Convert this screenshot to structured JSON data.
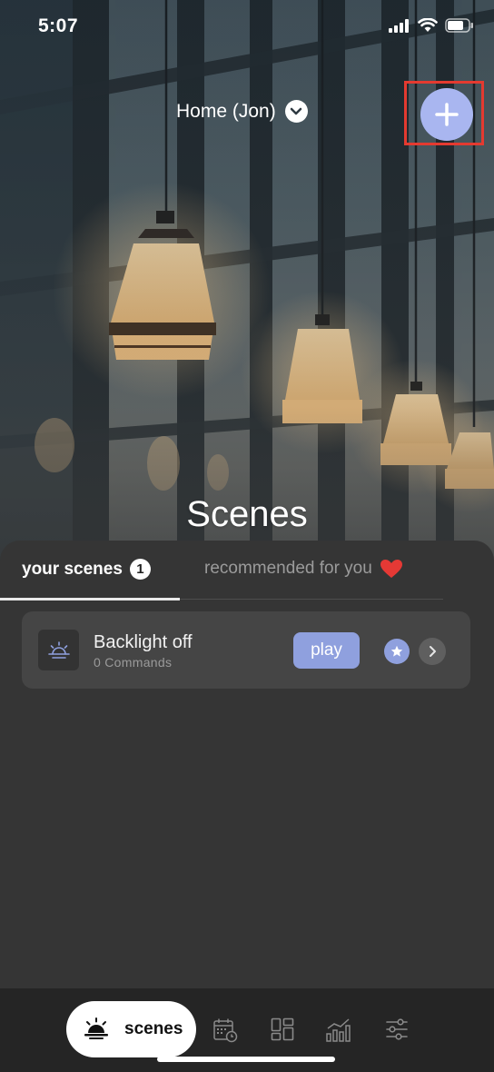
{
  "status_bar": {
    "time": "5:07"
  },
  "header": {
    "home_selector_label": "Home (Jon)",
    "page_title": "Scenes"
  },
  "tabs": [
    {
      "label": "your scenes",
      "badge": "1",
      "active": true
    },
    {
      "label": "recommended for you",
      "active": false
    }
  ],
  "scenes": [
    {
      "name": "Backlight off",
      "commands": "0 Commands",
      "play_label": "play",
      "icon": "sunrise-icon"
    }
  ],
  "bottom_nav": {
    "active_label": "scenes",
    "items": [
      {
        "name": "scenes",
        "icon": "sunrise-icon"
      },
      {
        "name": "schedule",
        "icon": "calendar-clock-icon"
      },
      {
        "name": "dashboard",
        "icon": "grid-layout-icon"
      },
      {
        "name": "analytics",
        "icon": "bar-chart-icon"
      },
      {
        "name": "settings",
        "icon": "sliders-icon"
      }
    ]
  },
  "colors": {
    "accent": "#a9b6f0",
    "play": "#8fa0de",
    "highlight": "#e43a30",
    "heart": "#e53935",
    "panel": "#353535",
    "card": "#454545",
    "nav": "#252525"
  }
}
